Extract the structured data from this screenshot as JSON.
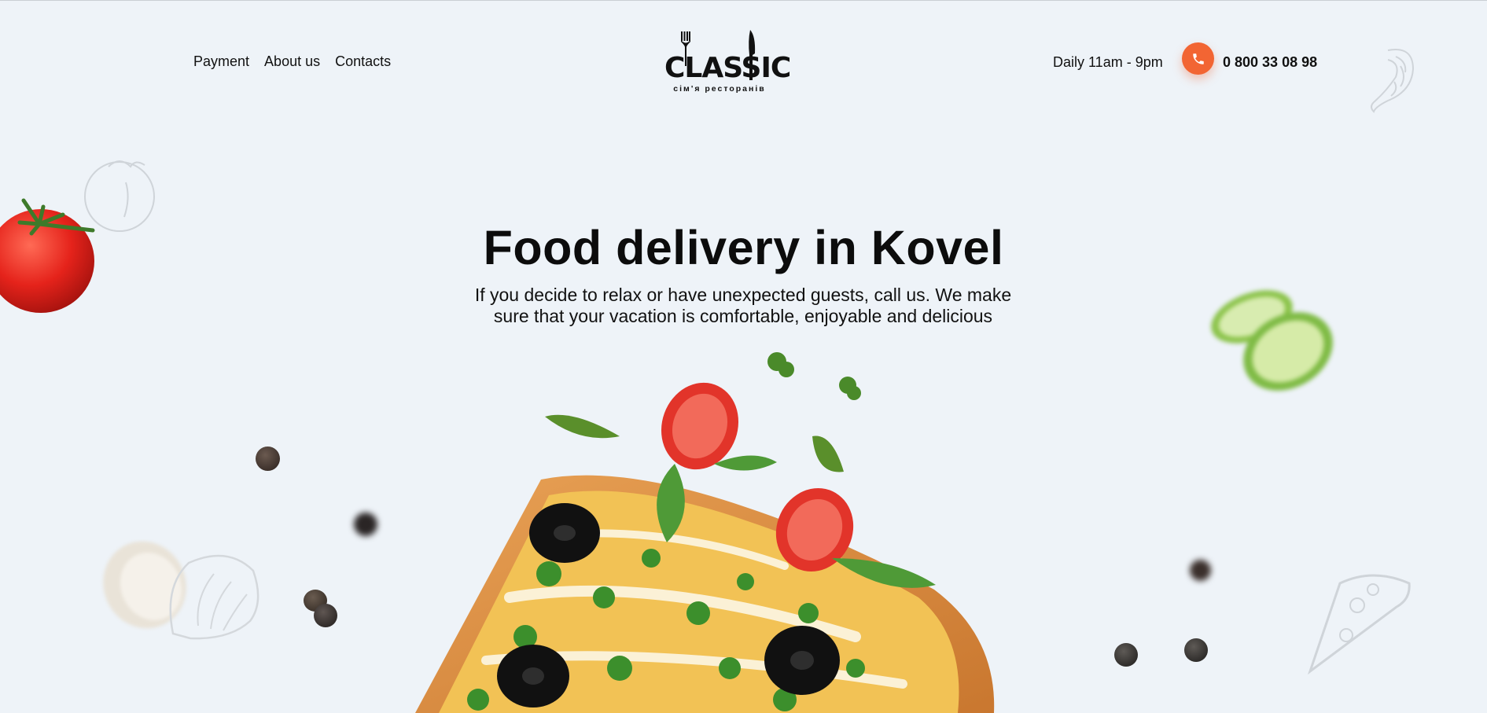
{
  "header": {
    "nav": [
      {
        "label": "Payment"
      },
      {
        "label": "About us"
      },
      {
        "label": "Contacts"
      }
    ],
    "logo": {
      "word": "CLASSIC",
      "tagline": "сім'я ресторанів"
    },
    "hours": "Daily 11am - 9pm",
    "phone": "0 800 33 08 98"
  },
  "hero": {
    "title": "Food delivery in Kovel",
    "subtitle": "If you decide to relax or have unexpected guests, call us. We make sure that your vacation is comfortable, enjoyable and delicious"
  },
  "colors": {
    "background": "#eef3f8",
    "accent": "#f26533",
    "text": "#111111"
  },
  "icons": [
    "phone-icon",
    "fork-icon",
    "knife-icon"
  ]
}
